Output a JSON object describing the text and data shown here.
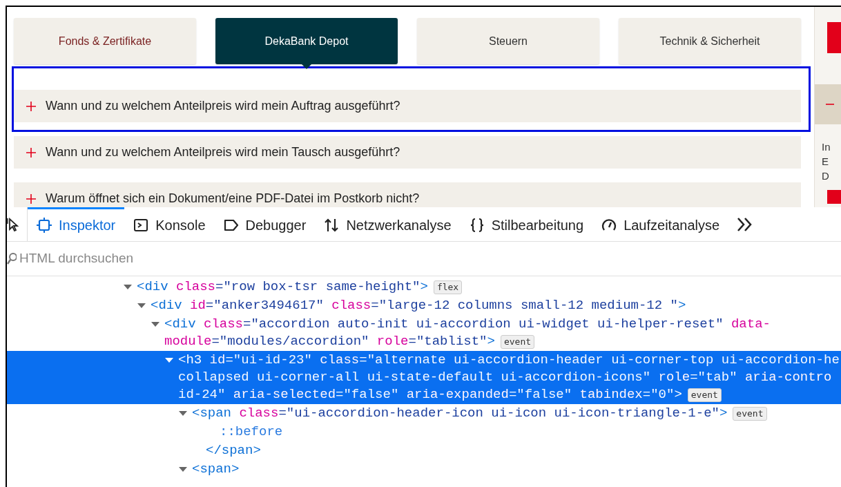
{
  "page": {
    "tabs": [
      {
        "label": "Fonds & Zertifikate",
        "selected": false
      },
      {
        "label": "DekaBank Depot",
        "selected": true
      },
      {
        "label": "Steuern",
        "selected": false
      },
      {
        "label": "Technik & Sicherheit",
        "selected": false
      }
    ],
    "faq": [
      {
        "question": "Wann und zu welchem Anteilpreis wird mein Auftrag ausgeführt?",
        "highlighted": true
      },
      {
        "question": "Wann und zu welchem Anteilpreis wird mein Tausch ausgeführt?",
        "highlighted": false
      },
      {
        "question": "Warum öffnet sich ein Dokument/eine PDF-Datei im Postkorb nicht?",
        "highlighted": false
      }
    ],
    "sidebar": {
      "texts": [
        "In",
        "E",
        "D"
      ]
    }
  },
  "devtools": {
    "tools": [
      {
        "label": "Inspektor",
        "kind": "inspector",
        "selected": true
      },
      {
        "label": "Konsole",
        "kind": "console",
        "selected": false
      },
      {
        "label": "Debugger",
        "kind": "debugger",
        "selected": false
      },
      {
        "label": "Netzwerkanalyse",
        "kind": "network",
        "selected": false
      },
      {
        "label": "Stilbearbeitung",
        "kind": "style",
        "selected": false
      },
      {
        "label": "Laufzeitanalyse",
        "kind": "performance",
        "selected": false
      }
    ],
    "search": {
      "placeholder": "HTML durchsuchen"
    },
    "tree": [
      {
        "kind": "element",
        "expanded": true,
        "selected": false,
        "badge": "flex",
        "lines": [
          [
            {
              "kind": "tag",
              "t": "<div"
            },
            {
              "kind": "attr",
              "t": " class"
            },
            {
              "kind": "value",
              "t": "=\"row box-tsr same-height\""
            },
            {
              "kind": "tag",
              "t": ">"
            }
          ]
        ],
        "children": [
          {
            "kind": "element",
            "expanded": true,
            "selected": false,
            "lines": [
              [
                {
                  "kind": "tag",
                  "t": "<div"
                },
                {
                  "kind": "attr",
                  "t": " id"
                },
                {
                  "kind": "value",
                  "t": "=\"anker3494617\""
                },
                {
                  "kind": "attr",
                  "t": " class"
                },
                {
                  "kind": "value",
                  "t": "=\"large-12 columns small-12 medium-12 \""
                },
                {
                  "kind": "tag",
                  "t": ">"
                }
              ]
            ],
            "children": [
              {
                "kind": "element",
                "expanded": true,
                "selected": false,
                "badge": "event",
                "lines": [
                  [
                    {
                      "kind": "tag",
                      "t": "<div"
                    },
                    {
                      "kind": "attr",
                      "t": " class"
                    },
                    {
                      "kind": "value",
                      "t": "=\"accordion auto-init ui-accordion ui-widget ui-helper-reset\""
                    },
                    {
                      "kind": "attr",
                      "t": " data-"
                    }
                  ],
                  [
                    {
                      "kind": "attr",
                      "t": "module"
                    },
                    {
                      "kind": "value",
                      "t": "=\"modules/accordion\""
                    },
                    {
                      "kind": "attr",
                      "t": " role"
                    },
                    {
                      "kind": "value",
                      "t": "=\"tablist\""
                    },
                    {
                      "kind": "tag",
                      "t": ">"
                    }
                  ]
                ],
                "children": [
                  {
                    "kind": "element",
                    "expanded": true,
                    "selected": true,
                    "badge": "event",
                    "lines": [
                      [
                        {
                          "kind": "tag",
                          "t": "<h3"
                        },
                        {
                          "kind": "attr",
                          "t": " id"
                        },
                        {
                          "kind": "value",
                          "t": "=\"ui-id-23\""
                        },
                        {
                          "kind": "attr",
                          "t": " class"
                        },
                        {
                          "kind": "value",
                          "t": "=\"alternate ui-accordion-header ui-corner-top ui-accordion-he"
                        }
                      ],
                      [
                        {
                          "kind": "value",
                          "t": "collapsed ui-corner-all ui-state-default ui-accordion-icons\""
                        },
                        {
                          "kind": "attr",
                          "t": " role"
                        },
                        {
                          "kind": "value",
                          "t": "=\"tab\""
                        },
                        {
                          "kind": "attr",
                          "t": " aria-contro"
                        }
                      ],
                      [
                        {
                          "kind": "value",
                          "t": "id-24\""
                        },
                        {
                          "kind": "attr",
                          "t": " aria-selected"
                        },
                        {
                          "kind": "value",
                          "t": "=\"false\""
                        },
                        {
                          "kind": "attr",
                          "t": " aria-expanded"
                        },
                        {
                          "kind": "value",
                          "t": "=\"false\""
                        },
                        {
                          "kind": "attr",
                          "t": " tabindex"
                        },
                        {
                          "kind": "value",
                          "t": "=\"0\""
                        },
                        {
                          "kind": "tag",
                          "t": ">"
                        }
                      ]
                    ],
                    "children": [
                      {
                        "kind": "element",
                        "expanded": true,
                        "selected": false,
                        "badge": "event",
                        "lines": [
                          [
                            {
                              "kind": "tag",
                              "t": "<span"
                            },
                            {
                              "kind": "attr",
                              "t": " class"
                            },
                            {
                              "kind": "value",
                              "t": "=\"ui-accordion-header-icon ui-icon ui-icon-triangle-1-e\""
                            },
                            {
                              "kind": "tag",
                              "t": ">"
                            }
                          ]
                        ],
                        "children": [
                          {
                            "kind": "pseudo",
                            "lines": [
                              [
                                {
                                  "kind": "pseudo",
                                  "t": "::before"
                                }
                              ]
                            ]
                          },
                          {
                            "kind": "close",
                            "lines": [
                              [
                                {
                                  "kind": "tag",
                                  "t": "</span>"
                                }
                              ]
                            ]
                          }
                        ]
                      },
                      {
                        "kind": "element",
                        "expanded": true,
                        "selected": false,
                        "lines": [
                          [
                            {
                              "kind": "tag",
                              "t": "<span"
                            },
                            {
                              "kind": "tag",
                              "t": ">"
                            }
                          ]
                        ]
                      }
                    ]
                  }
                ]
              }
            ]
          }
        ]
      }
    ]
  }
}
